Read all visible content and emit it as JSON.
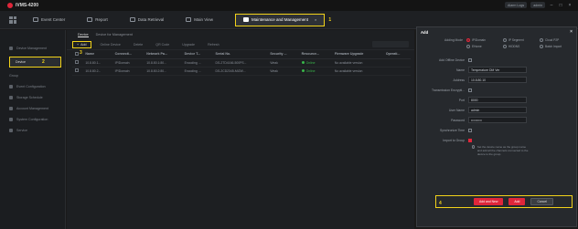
{
  "app": {
    "title": "iVMS-4200"
  },
  "titlebar": {
    "pill_1": "Alarm Logs",
    "pill_2": "admin"
  },
  "nav": {
    "tabs": [
      {
        "label": "Event Center"
      },
      {
        "label": "Report"
      },
      {
        "label": "Data Retrieval"
      },
      {
        "label": "Main View"
      },
      {
        "label": "Maintenance and Management"
      }
    ],
    "step_number": "1"
  },
  "sidebar": {
    "items": [
      {
        "label": "Device Management"
      },
      {
        "label": "Device"
      },
      {
        "label": "Group"
      },
      {
        "label": "Event Configuration"
      },
      {
        "label": "Storage Schedule"
      },
      {
        "label": "Account Management"
      },
      {
        "label": "System Configuration"
      },
      {
        "label": "Service"
      }
    ],
    "step_number": "2"
  },
  "main": {
    "subtabs": [
      "Device",
      "Device for Management"
    ],
    "toolbar": {
      "add_label": "Add",
      "items": [
        "Online Device",
        "Delete",
        "QR Code",
        "Upgrade",
        "Refresh"
      ],
      "step_number": "3"
    },
    "table": {
      "columns": [
        "Name",
        "Connecti...",
        "Network Pa...",
        "Device T...",
        "Serial No.",
        "Security ...",
        "Resource...",
        "Firmware Upgrade",
        "Operati..."
      ],
      "rows": [
        [
          "10.8.80.1...",
          "IP/Domain",
          "10.8.80.1:80...",
          "Encoding ...",
          "DS-2TD4166-500PS...",
          "Weak",
          "Online",
          "No available version",
          ""
        ],
        [
          "10.8.80.2...",
          "IP/Domain",
          "10.8.80.2:80...",
          "Encoding ...",
          "DS-2CD2345-MIZW...",
          "Weak",
          "Online",
          "No available version",
          ""
        ]
      ]
    }
  },
  "dialog": {
    "title": "Add",
    "adding_mode_label": "Adding Mode",
    "modes": [
      "IP/Domain",
      "IP Segment",
      "Cloud P2P",
      "EHome",
      "HIDDNS",
      "Batch Import"
    ],
    "add_offline_label": "Add Offline Device",
    "name_label": "Name",
    "name_value": "Temperature DM Ver",
    "address_label": "Address",
    "address_value": "10.8.80.10",
    "transmission_label": "Transmission Encrypti...",
    "port_label": "Port",
    "port_value": "8000",
    "username_label": "User Name",
    "username_value": "admin",
    "password_label": "Password",
    "password_value": "••••••••••",
    "sync_label": "Synchronize Time",
    "import_group_label": "Import to Group",
    "help_text": "Set the device name as the group name and add all the channels connected to the device to the group.",
    "btn_add_new": "Add and New",
    "btn_add": "Add",
    "btn_cancel": "Cancel",
    "step_number": "4"
  }
}
